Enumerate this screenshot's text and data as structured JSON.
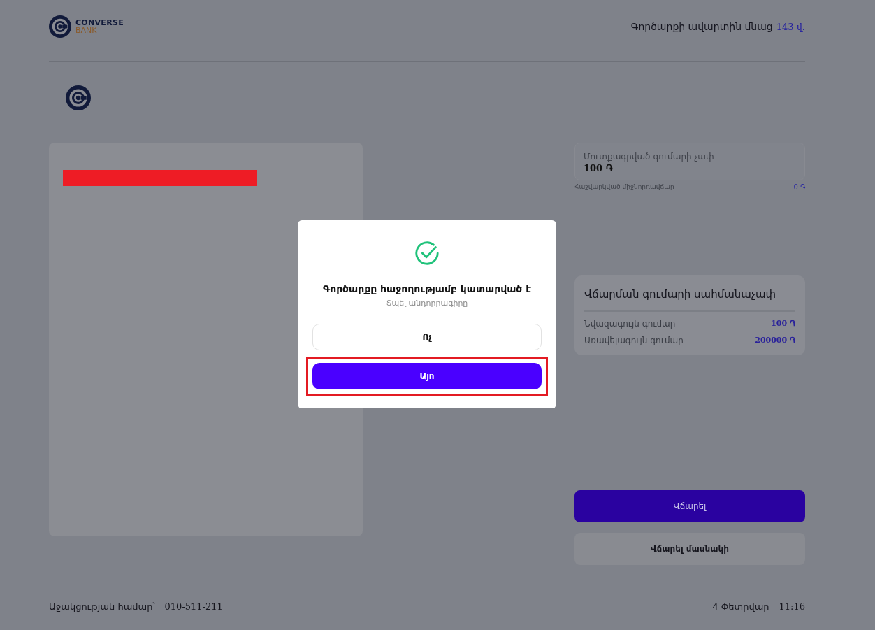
{
  "header": {
    "logo": {
      "name": "CONVERSE",
      "sub": "BANK"
    },
    "timer": {
      "label": "Գործարքի ավարտին մնաց",
      "value": "143 վ."
    }
  },
  "amount_card": {
    "label": "Մուտքագրված գումարի չափ",
    "value": "100 ֏"
  },
  "commission": {
    "label": "Հաշվարկված միջնորդավճար",
    "value": "0 ֏"
  },
  "limits": {
    "title": "Վճարման գումարի սահմանաչափ",
    "rows": [
      {
        "label": "Նվազագույն գումար",
        "value": "100 ֏"
      },
      {
        "label": "Առավելագույն գումար",
        "value": "200000 ֏"
      }
    ]
  },
  "actions": [
    {
      "label": "Վճարել",
      "kind": "primary"
    },
    {
      "label": "Վճարել մասնակի",
      "kind": "secondary"
    }
  ],
  "footer": {
    "support_label": "Աջակցության համար՝",
    "support_phone": "010-511-211",
    "date": "4 Փետրվար",
    "time": "11:16"
  },
  "dialog": {
    "title": "Գործարքը հաջողությամբ կատարված է",
    "subtitle": "Տպել անդորրագիրը",
    "buttons": [
      {
        "label": "Ոչ",
        "kind": "secondary",
        "highlighted": false
      },
      {
        "label": "Այո",
        "kind": "primary",
        "highlighted": true
      }
    ]
  }
}
